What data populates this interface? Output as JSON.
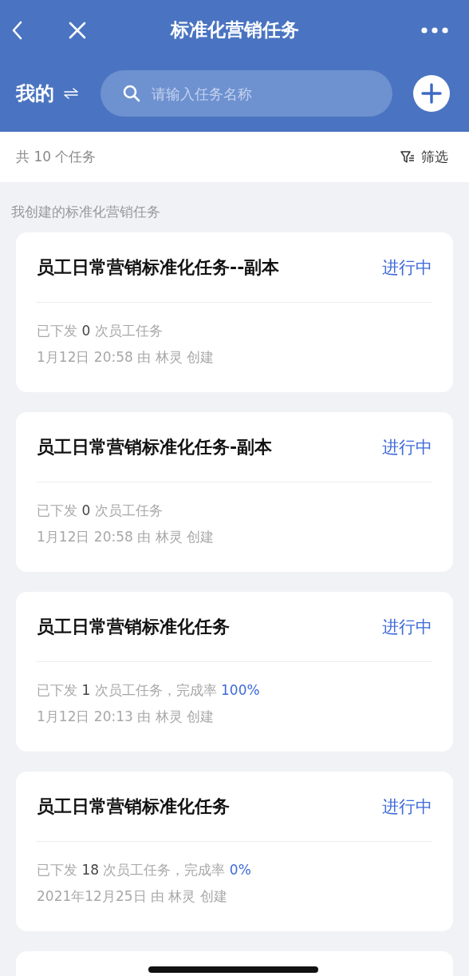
{
  "nav": {
    "title": "标准化营销任务"
  },
  "toolbar": {
    "scope": "我的",
    "search": {
      "placeholder": "请输入任务名称"
    }
  },
  "summary": {
    "count": "共 10 个任务",
    "filter": "筛选"
  },
  "section_title": "我创建的标准化营销任务",
  "tasks": [
    {
      "title": "员工日常营销标准化任务--副本",
      "status": "进行中",
      "stats": [
        {
          "kind": "plain",
          "text": "已下发 "
        },
        {
          "kind": "number",
          "text": "0"
        },
        {
          "kind": "plain",
          "text": " 次员工任务"
        }
      ],
      "created": "1月12日 20:58 由 林灵 创建"
    },
    {
      "title": "员工日常营销标准化任务-副本",
      "status": "进行中",
      "stats": [
        {
          "kind": "plain",
          "text": "已下发 "
        },
        {
          "kind": "number",
          "text": "0"
        },
        {
          "kind": "plain",
          "text": " 次员工任务"
        }
      ],
      "created": "1月12日 20:58 由 林灵 创建"
    },
    {
      "title": "员工日常营销标准化任务",
      "status": "进行中",
      "stats": [
        {
          "kind": "plain",
          "text": "已下发 "
        },
        {
          "kind": "number",
          "text": "1"
        },
        {
          "kind": "plain",
          "text": " 次员工任务，完成率 "
        },
        {
          "kind": "rate",
          "text": "100%"
        }
      ],
      "created": "1月12日 20:13 由 林灵 创建"
    },
    {
      "title": "员工日常营销标准化任务",
      "status": "进行中",
      "stats": [
        {
          "kind": "plain",
          "text": "已下发 "
        },
        {
          "kind": "number",
          "text": "18"
        },
        {
          "kind": "plain",
          "text": " 次员工任务，完成率 "
        },
        {
          "kind": "rate",
          "text": "0%"
        }
      ],
      "created": "2021年12月25日 由 林灵 创建"
    }
  ]
}
